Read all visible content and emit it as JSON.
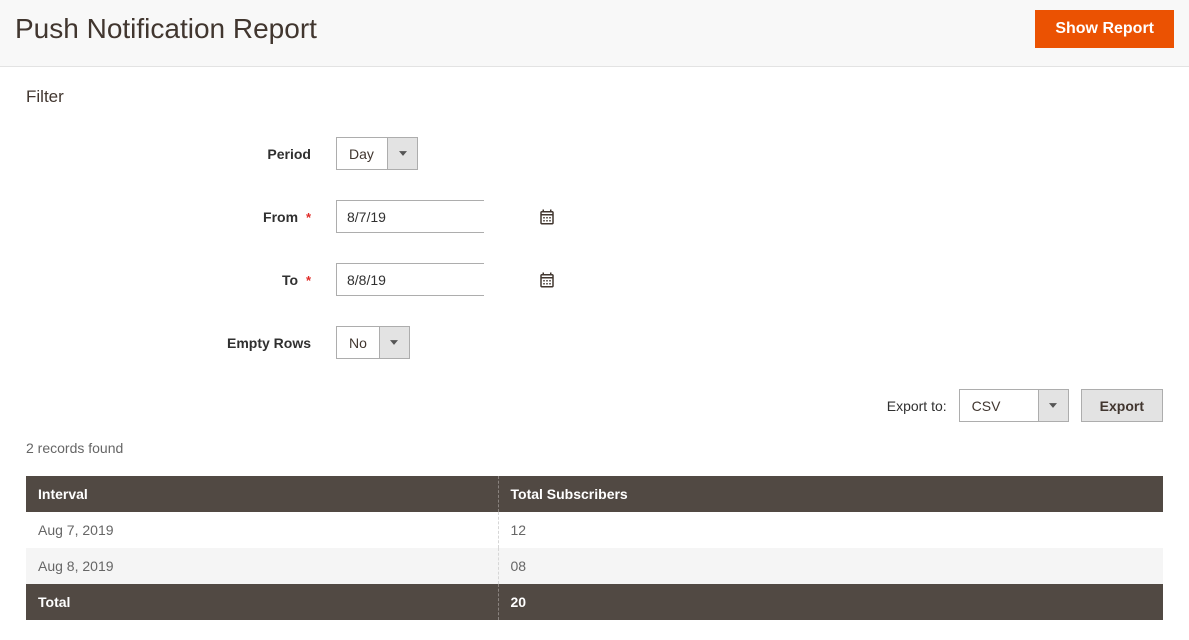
{
  "header": {
    "title": "Push Notification Report",
    "show_report_label": "Show Report"
  },
  "filter": {
    "section_title": "Filter",
    "period_label": "Period",
    "period_value": "Day",
    "from_label": "From",
    "from_value": "8/7/19",
    "to_label": "To",
    "to_value": "8/8/19",
    "empty_rows_label": "Empty Rows",
    "empty_rows_value": "No"
  },
  "export": {
    "label": "Export to:",
    "format_value": "CSV",
    "button_label": "Export"
  },
  "records_found": "2 records found",
  "table": {
    "columns": {
      "interval": "Interval",
      "total_subscribers": "Total Subscribers"
    },
    "rows": [
      {
        "interval": "Aug 7, 2019",
        "total_subscribers": "12"
      },
      {
        "interval": "Aug 8, 2019",
        "total_subscribers": "08"
      }
    ],
    "footer": {
      "label": "Total",
      "total_subscribers": "20"
    }
  }
}
